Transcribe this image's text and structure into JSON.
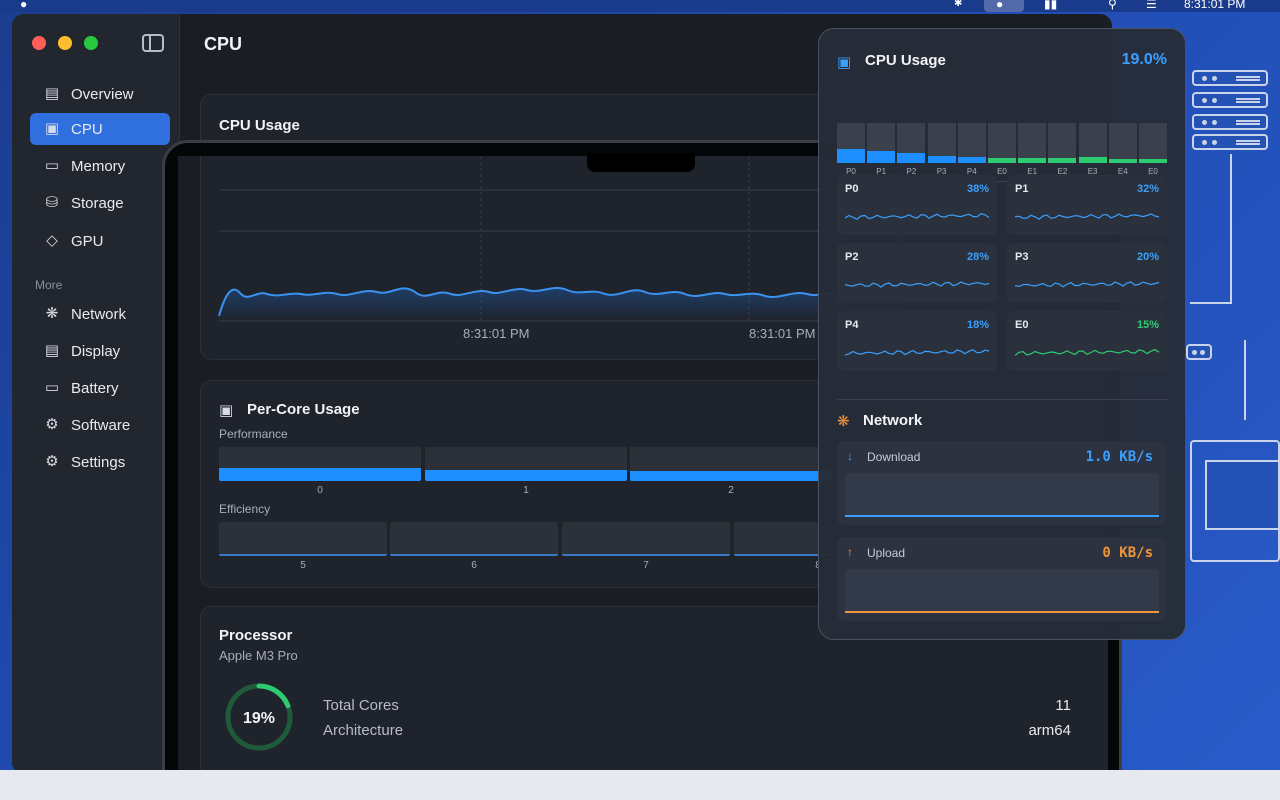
{
  "menubar": {
    "clock": "8:31:01 PM"
  },
  "window": {
    "title": "CPU"
  },
  "sidebar": {
    "items": [
      {
        "label": "Overview",
        "icon": "monitor-icon"
      },
      {
        "label": "CPU",
        "icon": "cpu-icon",
        "active": true
      },
      {
        "label": "Memory",
        "icon": "memory-icon"
      },
      {
        "label": "Storage",
        "icon": "storage-icon"
      },
      {
        "label": "GPU",
        "icon": "layers-icon"
      }
    ],
    "more_label": "More",
    "more_items": [
      {
        "label": "Network",
        "icon": "globe-icon"
      },
      {
        "label": "Display",
        "icon": "display-icon"
      },
      {
        "label": "Battery",
        "icon": "battery-icon"
      },
      {
        "label": "Software",
        "icon": "gears-icon"
      },
      {
        "label": "Settings",
        "icon": "gear-icon"
      }
    ]
  },
  "cpu_usage_card": {
    "title": "CPU Usage",
    "time_labels": [
      "8:31:01 PM",
      "8:31:01 PM"
    ]
  },
  "per_core_card": {
    "title": "Per-Core Usage",
    "performance_label": "Performance",
    "efficiency_label": "Efficiency",
    "performance_cores": [
      {
        "label": "0",
        "value": 0.38
      },
      {
        "label": "1",
        "value": 0.32
      },
      {
        "label": "2",
        "value": 0.28
      }
    ],
    "efficiency_cores": [
      {
        "label": "5",
        "value": 0.1
      },
      {
        "label": "6",
        "value": 0.1
      },
      {
        "label": "7",
        "value": 0.1
      },
      {
        "label": "8",
        "value": 0.1
      }
    ]
  },
  "processor_card": {
    "title": "Processor",
    "model": "Apple M3 Pro",
    "usage_text": "19%",
    "usage": 0.19,
    "total_cores_label": "Total Cores",
    "total_cores_value": "11",
    "architecture_label": "Architecture",
    "architecture_value": "arm64"
  },
  "popover": {
    "cpu_title": "CPU Usage",
    "cpu_value": "19.0%",
    "mini_bars": [
      {
        "label": "P0",
        "value": 0.38,
        "kind": "p"
      },
      {
        "label": "P1",
        "value": 0.32,
        "kind": "p"
      },
      {
        "label": "P2",
        "value": 0.28,
        "kind": "p"
      },
      {
        "label": "P3",
        "value": 0.2,
        "kind": "p"
      },
      {
        "label": "P4",
        "value": 0.18,
        "kind": "p"
      },
      {
        "label": "E0",
        "value": 0.15,
        "kind": "e"
      },
      {
        "label": "E1",
        "value": 0.14,
        "kind": "e"
      },
      {
        "label": "E2",
        "value": 0.14,
        "kind": "e"
      },
      {
        "label": "E3",
        "value": 0.16,
        "kind": "e"
      },
      {
        "label": "E4",
        "value": 0.08,
        "kind": "e"
      },
      {
        "label": "E0",
        "value": 0.06,
        "kind": "e"
      }
    ],
    "cores": [
      {
        "name": "P0",
        "percent": "38%",
        "kind": "p"
      },
      {
        "name": "P1",
        "percent": "32%",
        "kind": "p"
      },
      {
        "name": "P2",
        "percent": "28%",
        "kind": "p"
      },
      {
        "name": "P3",
        "percent": "20%",
        "kind": "p"
      },
      {
        "name": "P4",
        "percent": "18%",
        "kind": "p"
      },
      {
        "name": "E0",
        "percent": "15%",
        "kind": "e"
      }
    ],
    "network_title": "Network",
    "download_label": "Download",
    "download_value": "1.0 KB/s",
    "upload_label": "Upload",
    "upload_value": "0 KB/s"
  },
  "colors": {
    "accent": "#2f6fde",
    "performance": "#1e8fff",
    "efficiency": "#2ecc71",
    "upload": "#f0953a"
  }
}
